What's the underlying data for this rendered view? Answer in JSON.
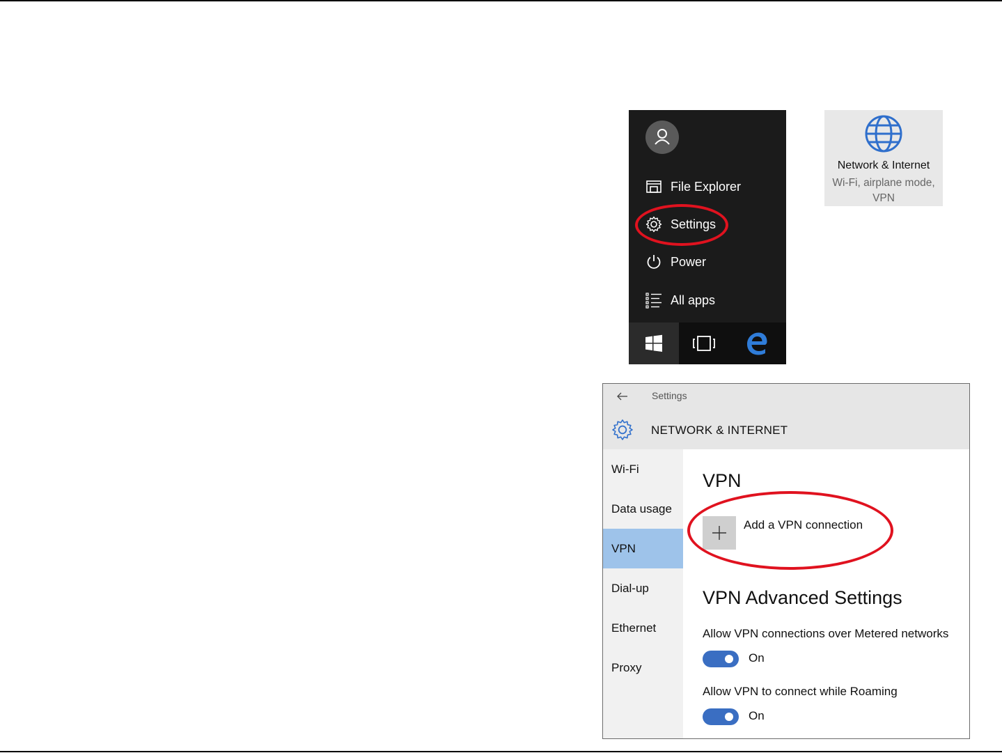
{
  "start_menu": {
    "items": [
      {
        "label": "File Explorer",
        "icon": "folder-icon"
      },
      {
        "label": "Settings",
        "icon": "gear-icon"
      },
      {
        "label": "Power",
        "icon": "power-icon"
      },
      {
        "label": "All apps",
        "icon": "list-icon"
      }
    ],
    "taskbar": [
      {
        "icon": "windows-icon",
        "active": true
      },
      {
        "icon": "task-view-icon",
        "active": false
      },
      {
        "icon": "edge-icon",
        "active": false
      }
    ]
  },
  "network_tile": {
    "title": "Network & Internet",
    "subtitle_line1": "Wi-Fi, airplane mode,",
    "subtitle_line2": "VPN",
    "icon": "globe-icon"
  },
  "settings_window": {
    "caption": "Settings",
    "header_title": "NETWORK & INTERNET",
    "nav": [
      {
        "label": "Wi-Fi",
        "selected": false
      },
      {
        "label": "Data usage",
        "selected": false
      },
      {
        "label": "VPN",
        "selected": true
      },
      {
        "label": "Dial-up",
        "selected": false
      },
      {
        "label": "Ethernet",
        "selected": false
      },
      {
        "label": "Proxy",
        "selected": false
      }
    ],
    "vpn_heading": "VPN",
    "add_vpn_label": "Add a VPN connection",
    "advanced_heading": "VPN Advanced Settings",
    "options": [
      {
        "label": "Allow VPN connections over Metered networks",
        "state": "On"
      },
      {
        "label": "Allow VPN to connect while Roaming",
        "state": "On"
      }
    ]
  },
  "colors": {
    "annotation": "#e0121f",
    "accent": "#3a6ec2",
    "nav_selected": "#9ec3ea",
    "start_bg": "#1b1b1b"
  }
}
